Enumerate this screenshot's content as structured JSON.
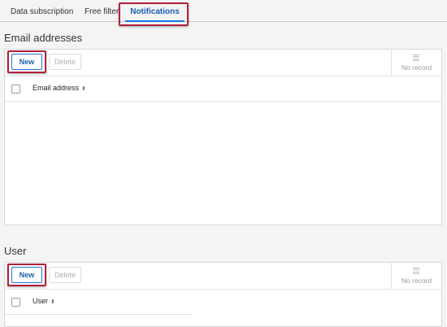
{
  "tabs": [
    {
      "label": "Data subscription"
    },
    {
      "label": "Free filter"
    },
    {
      "label": "Notifications",
      "active": true
    }
  ],
  "sections": [
    {
      "title": "Email addresses",
      "toolbar": {
        "new_label": "New",
        "delete_label": "Delete",
        "empty_label": "No record"
      },
      "columns": [
        {
          "label": "Email address",
          "sort_icon": "sort-icon"
        }
      ]
    },
    {
      "title": "User",
      "toolbar": {
        "new_label": "New",
        "delete_label": "Delete",
        "empty_label": "No record"
      },
      "columns": [
        {
          "label": "User",
          "sort_icon": "sort-icon"
        }
      ]
    }
  ],
  "colors": {
    "accent": "#1a73e8",
    "highlight": "#b0203a"
  }
}
